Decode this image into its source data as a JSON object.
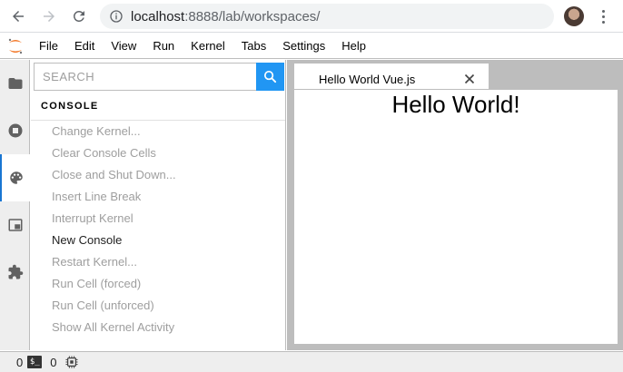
{
  "browser": {
    "url_host": "localhost",
    "url_path": ":8888/lab/workspaces/"
  },
  "menubar": {
    "items": [
      "File",
      "Edit",
      "View",
      "Run",
      "Kernel",
      "Tabs",
      "Settings",
      "Help"
    ]
  },
  "activity_bar": {
    "icons": [
      "folder-icon",
      "running-icon",
      "palette-icon",
      "tabs-icon",
      "extension-icon"
    ],
    "active": "palette-icon"
  },
  "palette": {
    "search_placeholder": "SEARCH",
    "section": "CONSOLE",
    "commands": [
      {
        "label": "Change Kernel...",
        "enabled": false
      },
      {
        "label": "Clear Console Cells",
        "enabled": false
      },
      {
        "label": "Close and Shut Down...",
        "enabled": false
      },
      {
        "label": "Insert Line Break",
        "enabled": false
      },
      {
        "label": "Interrupt Kernel",
        "enabled": false
      },
      {
        "label": "New Console",
        "enabled": true
      },
      {
        "label": "Restart Kernel...",
        "enabled": false
      },
      {
        "label": "Run Cell (forced)",
        "enabled": false
      },
      {
        "label": "Run Cell (unforced)",
        "enabled": false
      },
      {
        "label": "Show All Kernel Activity",
        "enabled": false
      }
    ]
  },
  "main": {
    "tab_label": "Hello World Vue.js",
    "content_text": "Hello World!"
  },
  "statusbar": {
    "terminals": "0",
    "terminal_icon_text": "$_",
    "kernels": "0"
  },
  "colors": {
    "accent": "#2196f3",
    "disabled_text": "#9e9e9e",
    "dock_background": "#bdbdbd"
  }
}
